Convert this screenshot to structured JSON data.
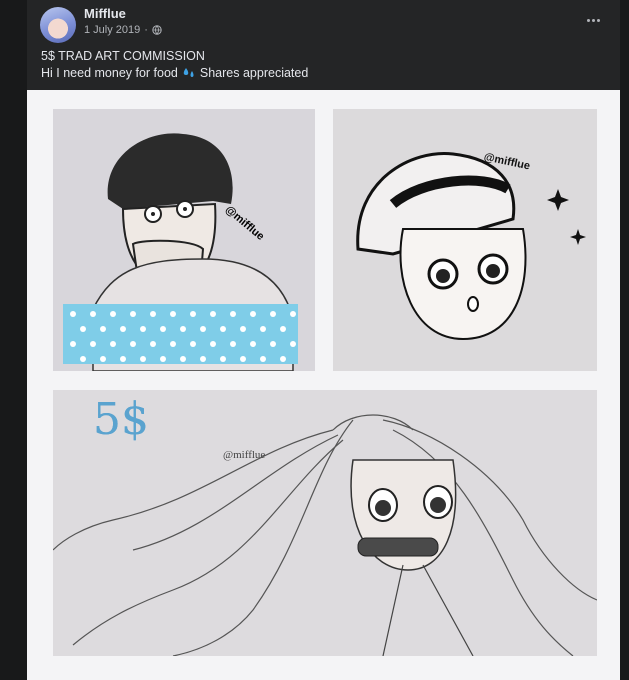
{
  "post": {
    "author": "Mifflue",
    "date": "1 July 2019",
    "separator": "·",
    "line1": "5$ TRAD ART COMMISSION",
    "line2_before": "Hi I need money for food",
    "line2_after": "Shares appreciated"
  },
  "media": {
    "price_label": "5$",
    "watermarks": [
      "@mifflue",
      "@mifflue",
      "@mifflue"
    ]
  },
  "colors": {
    "page_bg": "#18191a",
    "card_bg": "#242526",
    "text_primary": "#e4e6eb",
    "text_secondary": "#b0b3b8",
    "accent_blue": "#5aa3cf"
  },
  "icons": [
    "avatar",
    "globe-icon",
    "more-options-icon",
    "sweat-droplets-icon"
  ]
}
